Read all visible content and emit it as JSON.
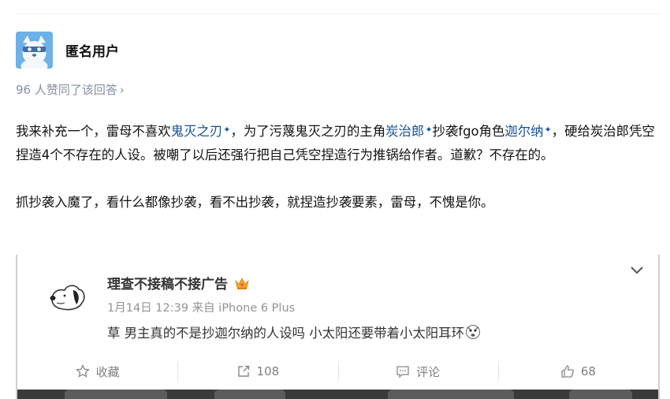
{
  "author": {
    "name": "匿名用户",
    "avatar": "anonymous-avatar-icon"
  },
  "upvotes": {
    "text": "96 人赞同了该回答",
    "chevron": "›"
  },
  "content": {
    "p1_a": "我来补充一个，雷母不喜欢",
    "link1": "鬼灭之刃",
    "p1_b": "，为了污蔑鬼灭之刃的主角",
    "link2": "炭治郎",
    "p1_c": "抄袭fgo角色",
    "link3": "迦尔纳",
    "p1_d": "，硬给炭治郎凭空捏造4个不存在的人设。被嘲了以后还强行把自己凭空捏造行为推锅给作者。道歉？不存在的。",
    "p2": "抓抄袭入魔了，看什么都像抄袭，看不出抄袭，就捏造抄袭要素，雷母，不愧是你。",
    "spark": "✦"
  },
  "embedded_post": {
    "username": "理查不接稿不接广告",
    "meta": "1月14日 12:39 来自 iPhone 6 Plus",
    "text": "草 男主真的不是抄迦尔纳的人设吗 小太阳还要带着小太阳耳环",
    "actions": {
      "favorite_label": "收藏",
      "repost_count": "108",
      "comment_label": "评论",
      "like_count": "68"
    }
  },
  "colors": {
    "link": "#175199",
    "muted": "#8590a6",
    "avatar_bg": "#6db1e6"
  }
}
